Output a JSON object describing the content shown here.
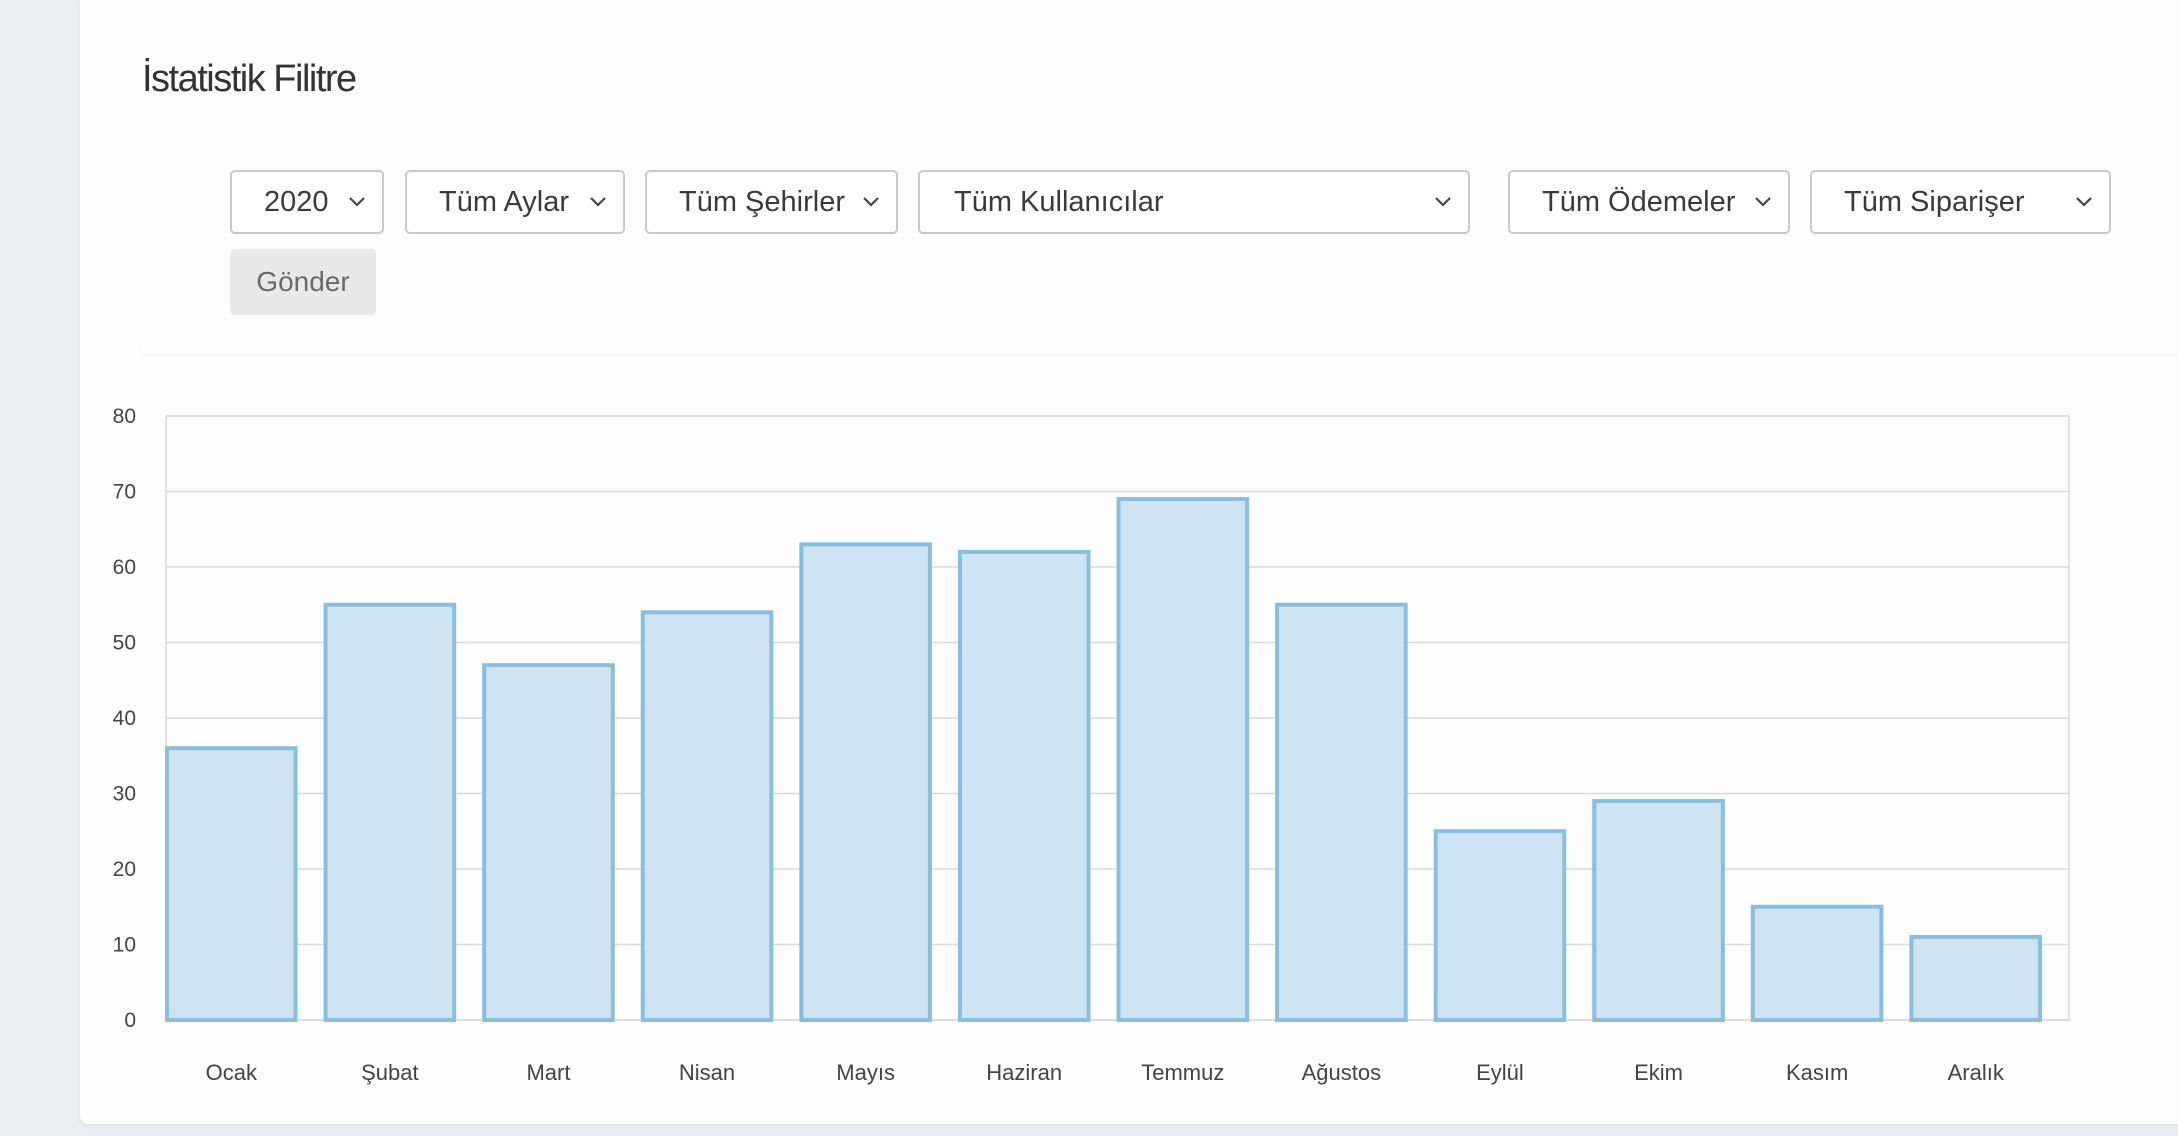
{
  "page": {
    "title": "İstatistik Filitre"
  },
  "filters": {
    "year": "2020",
    "month": "Tüm Aylar",
    "city": "Tüm Şehirler",
    "user": "Tüm Kullanıcılar",
    "payment": "Tüm Ödemeler",
    "order": "Tüm Siparişer",
    "submit_label": "Gönder"
  },
  "icons": {
    "dropdown": "chevron-down-icon"
  },
  "colors": {
    "bar_fill": "#cfe4f3",
    "bar_stroke": "#86bfe0",
    "grid": "#d9d9d9"
  },
  "chart_data": {
    "type": "bar",
    "categories": [
      "Ocak",
      "Şubat",
      "Mart",
      "Nisan",
      "Mayıs",
      "Haziran",
      "Temmuz",
      "Ağustos",
      "Eylül",
      "Ekim",
      "Kasım",
      "Aralık"
    ],
    "values": [
      36,
      55,
      47,
      54,
      63,
      62,
      69,
      55,
      25,
      29,
      15,
      11
    ],
    "ylim": [
      0,
      80
    ],
    "yticks": [
      0,
      10,
      20,
      30,
      40,
      50,
      60,
      70,
      80
    ],
    "grid": true
  }
}
